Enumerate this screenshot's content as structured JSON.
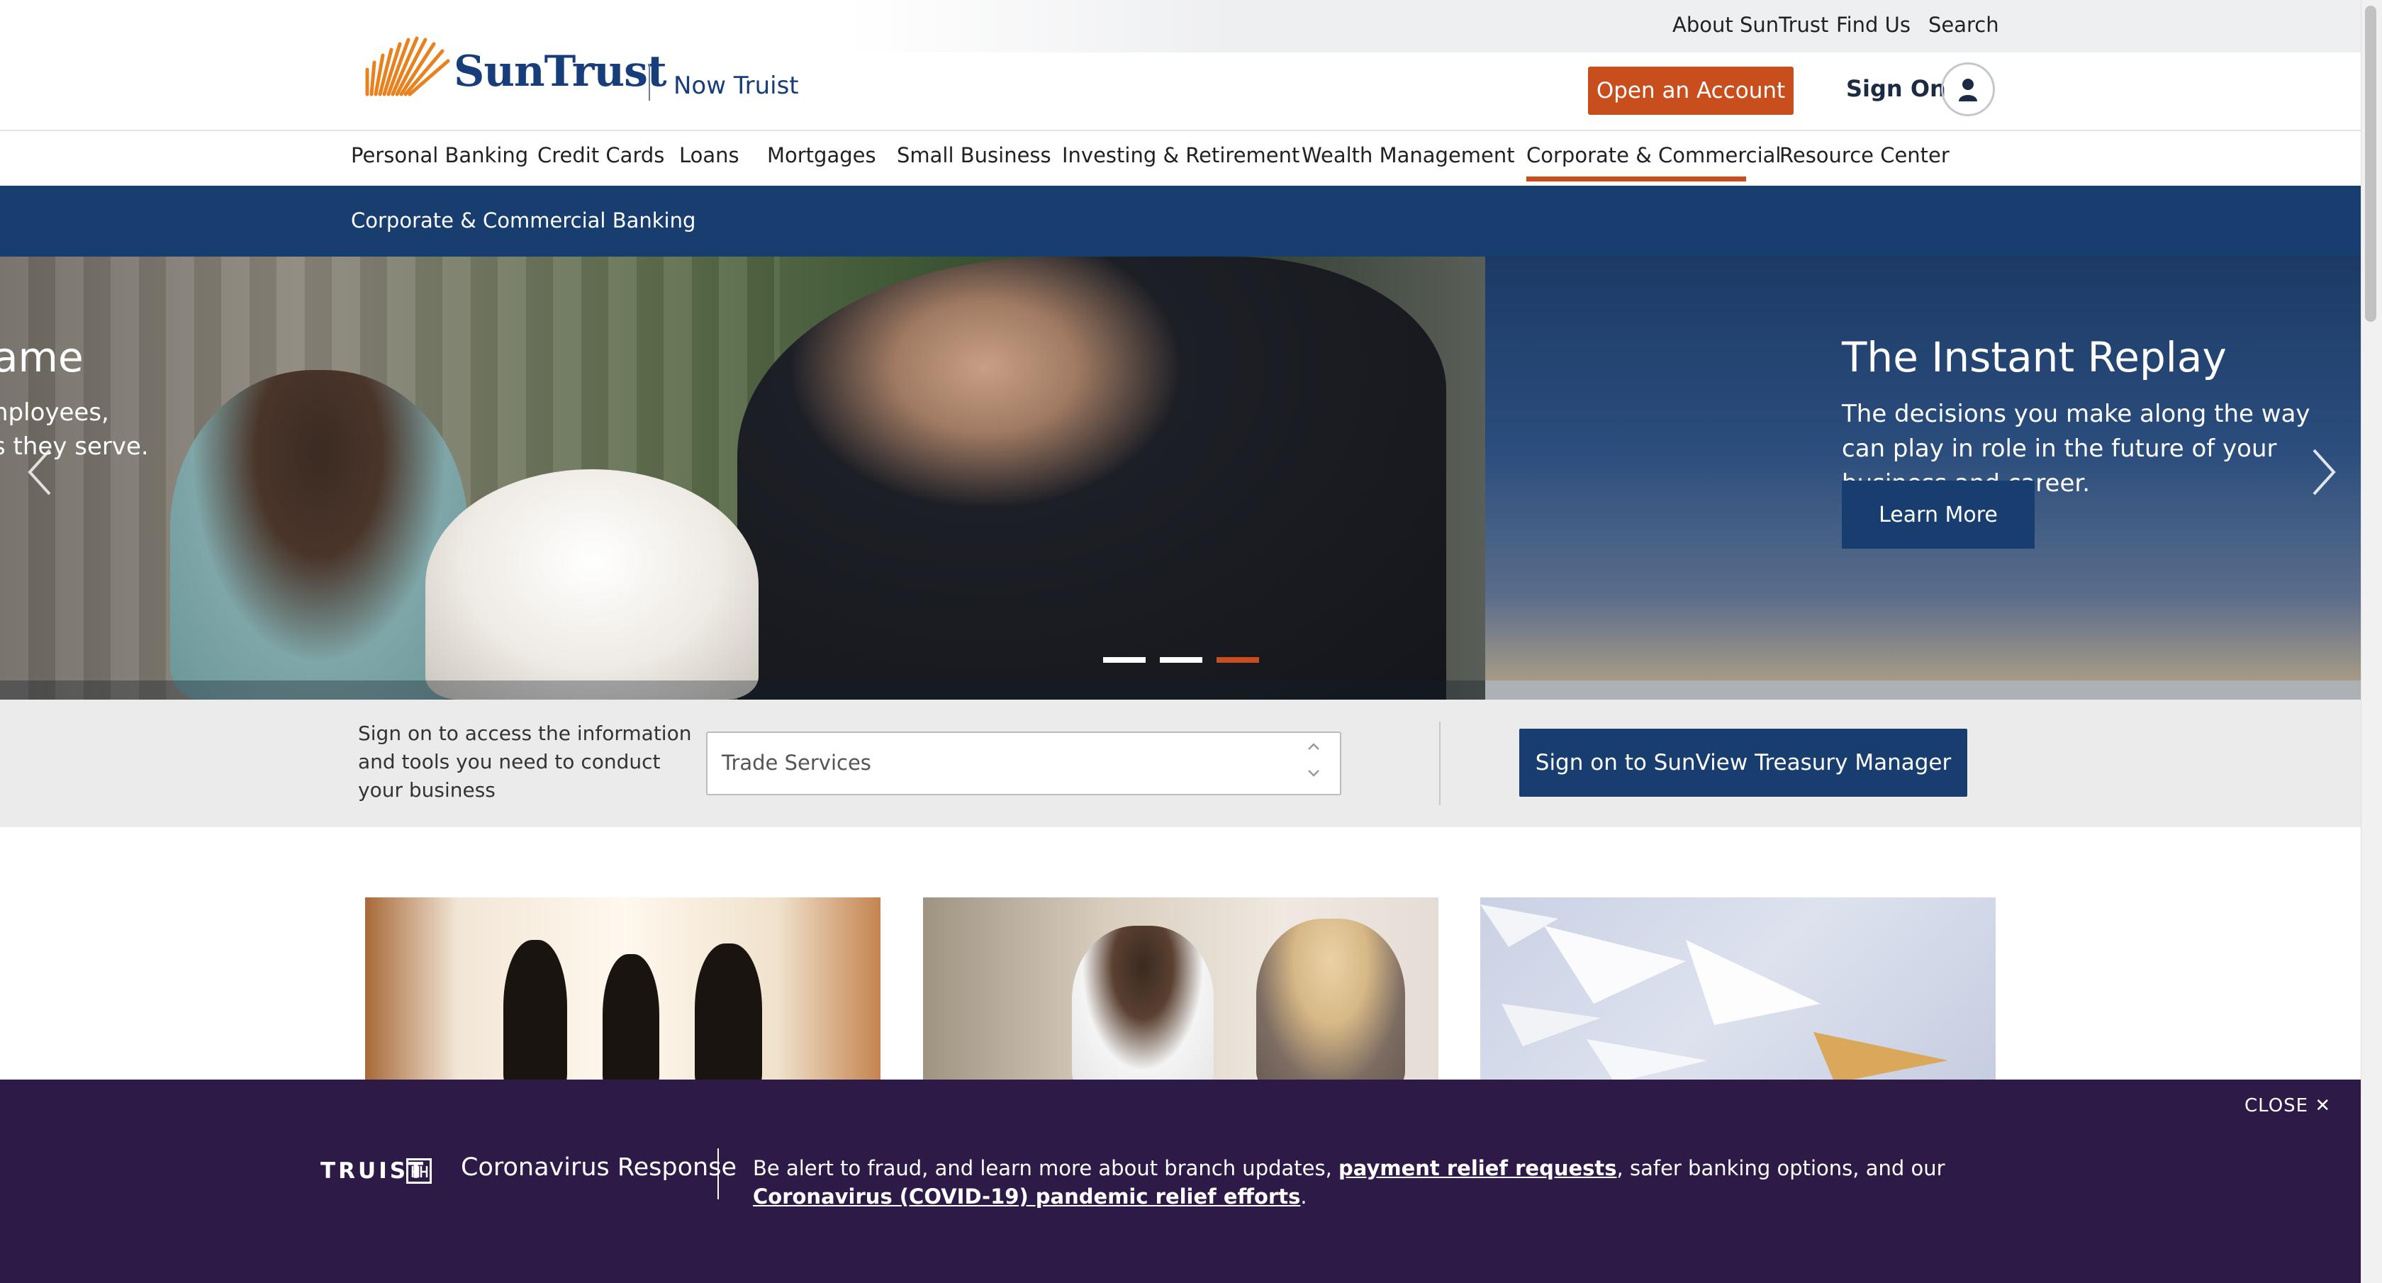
{
  "utility": {
    "about": "About SunTrust",
    "find_us": "Find Us",
    "search": "Search"
  },
  "brand": {
    "name": "SunTrust",
    "sub": "Now Truist",
    "color": "#173d7a"
  },
  "header": {
    "open_account": "Open an Account",
    "sign_on": "Sign On",
    "accent": "#c84e1e"
  },
  "nav": {
    "items": [
      "Personal Banking",
      "Credit Cards",
      "Loans",
      "Mortgages",
      "Small Business",
      "Investing & Retirement",
      "Wealth Management",
      "Corporate & Commercial",
      "Resource Center"
    ],
    "active": "Corporate & Commercial"
  },
  "subnav": {
    "label": "Corporate & Commercial Banking"
  },
  "hero": {
    "prev_slide_title": "ame",
    "prev_slide_line1": "nployees,",
    "prev_slide_line2": "s they serve.",
    "title": "The Instant Replay",
    "description": "The decisions you make along the way can play in role in the future of your business and career.",
    "button": "Learn More",
    "slide_count": 3,
    "active_slide": 3
  },
  "signon_strip": {
    "description": "Sign on to access the information and tools you need to conduct your business",
    "selected_service": "Trade Services",
    "button": "Sign on to SunView Treasury Manager"
  },
  "covid": {
    "close": "CLOSE",
    "brand": "TRUIST",
    "title": "Coronavirus Response",
    "text_1": "Be alert to fraud, and learn more about branch updates, ",
    "link_1": "payment relief requests",
    "text_2": ", safer banking options, and our ",
    "link_2": "Coronavirus (COVID-19) pandemic relief efforts",
    "text_3": ".",
    "bg": "#2e1a47"
  }
}
